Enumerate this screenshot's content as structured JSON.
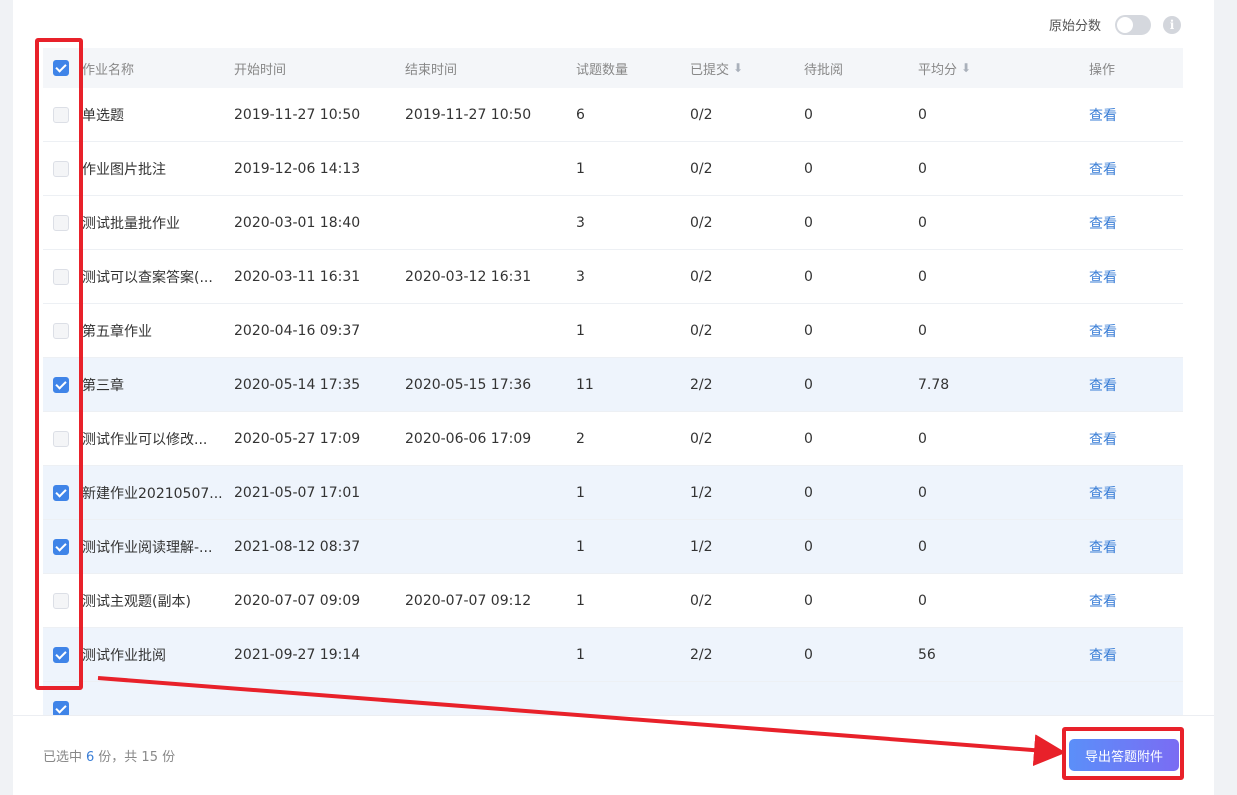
{
  "header": {
    "original_score_label": "原始分数",
    "info_icon": "i"
  },
  "table": {
    "columns": {
      "name": "作业名称",
      "start": "开始时间",
      "end": "结束时间",
      "count": "试题数量",
      "submitted": "已提交",
      "pending": "待批阅",
      "average": "平均分",
      "action": "操作"
    },
    "rows": [
      {
        "checked": false,
        "name": "单选题",
        "start": "2019-11-27 10:50",
        "end": "2019-11-27 10:50",
        "count": "6",
        "submitted": "0/2",
        "pending": "0",
        "average": "0",
        "action": "查看"
      },
      {
        "checked": false,
        "name": "作业图片批注",
        "start": "2019-12-06 14:13",
        "end": "",
        "count": "1",
        "submitted": "0/2",
        "pending": "0",
        "average": "0",
        "action": "查看"
      },
      {
        "checked": false,
        "name": "测试批量批作业",
        "start": "2020-03-01 18:40",
        "end": "",
        "count": "3",
        "submitted": "0/2",
        "pending": "0",
        "average": "0",
        "action": "查看"
      },
      {
        "checked": false,
        "name": "测试可以查案答案(...",
        "start": "2020-03-11 16:31",
        "end": "2020-03-12 16:31",
        "count": "3",
        "submitted": "0/2",
        "pending": "0",
        "average": "0",
        "action": "查看"
      },
      {
        "checked": false,
        "name": "第五章作业",
        "start": "2020-04-16 09:37",
        "end": "",
        "count": "1",
        "submitted": "0/2",
        "pending": "0",
        "average": "0",
        "action": "查看"
      },
      {
        "checked": true,
        "name": "第三章",
        "start": "2020-05-14 17:35",
        "end": "2020-05-15 17:36",
        "count": "11",
        "submitted": "2/2",
        "pending": "0",
        "average": "7.78",
        "action": "查看"
      },
      {
        "checked": false,
        "name": "测试作业可以修改...",
        "start": "2020-05-27 17:09",
        "end": "2020-06-06 17:09",
        "count": "2",
        "submitted": "0/2",
        "pending": "0",
        "average": "0",
        "action": "查看"
      },
      {
        "checked": true,
        "name": "新建作业20210507...",
        "start": "2021-05-07 17:01",
        "end": "",
        "count": "1",
        "submitted": "1/2",
        "pending": "0",
        "average": "0",
        "action": "查看"
      },
      {
        "checked": true,
        "name": "测试作业阅读理解-...",
        "start": "2021-08-12 08:37",
        "end": "",
        "count": "1",
        "submitted": "1/2",
        "pending": "0",
        "average": "0",
        "action": "查看"
      },
      {
        "checked": false,
        "name": "测试主观题(副本)",
        "start": "2020-07-07 09:09",
        "end": "2020-07-07 09:12",
        "count": "1",
        "submitted": "0/2",
        "pending": "0",
        "average": "0",
        "action": "查看"
      },
      {
        "checked": true,
        "name": "测试作业批阅",
        "start": "2021-09-27 19:14",
        "end": "",
        "count": "1",
        "submitted": "2/2",
        "pending": "0",
        "average": "56",
        "action": "查看"
      },
      {
        "checked": true,
        "name": "",
        "start": "",
        "end": "",
        "count": "",
        "submitted": "",
        "pending": "",
        "average": "",
        "action": ""
      }
    ]
  },
  "footer": {
    "selected_prefix": "已选中",
    "selected_count": "6",
    "selected_suffix": "份，共 15 份",
    "export_label": "导出答题附件"
  },
  "colors": {
    "accent": "#3f84e8",
    "highlight": "#e8212a"
  }
}
